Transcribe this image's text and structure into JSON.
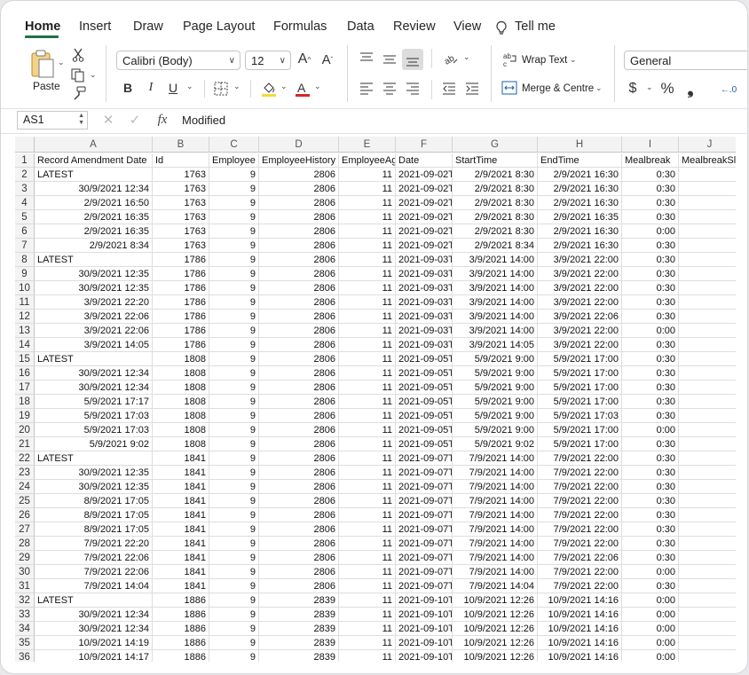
{
  "ribbon": {
    "tabs": [
      "Home",
      "Insert",
      "Draw",
      "Page Layout",
      "Formulas",
      "Data",
      "Review",
      "View",
      "Tell me"
    ],
    "active_tab": "Home",
    "paste_label": "Paste",
    "font_name": "Calibri (Body)",
    "font_size": "12",
    "wrap_text_label": "Wrap Text",
    "merge_label": "Merge & Centre",
    "number_format": "General",
    "accent_color": "#1e7145",
    "highlight_color": "#f4d83a",
    "font_color": "#d9262c"
  },
  "formula_bar": {
    "name_box": "AS1",
    "fx_label": "fx",
    "content": "Modified"
  },
  "sheet": {
    "columns": [
      "A",
      "B",
      "C",
      "D",
      "E",
      "F",
      "G",
      "H",
      "I",
      "J"
    ],
    "rows": [
      [
        "Record Amendment Date",
        "Id",
        "Employee",
        "EmployeeHistory",
        "EmployeeAg",
        "Date",
        "StartTime",
        "EndTime",
        "Mealbreak",
        "MealbreakSl"
      ],
      [
        "LATEST",
        "1763",
        "9",
        "2806",
        "11",
        "2021-09-02T",
        "2/9/2021 8:30",
        "2/9/2021 16:30",
        "0:30",
        ""
      ],
      [
        "30/9/2021 12:34",
        "1763",
        "9",
        "2806",
        "11",
        "2021-09-02T",
        "2/9/2021 8:30",
        "2/9/2021 16:30",
        "0:30",
        ""
      ],
      [
        "2/9/2021 16:50",
        "1763",
        "9",
        "2806",
        "11",
        "2021-09-02T",
        "2/9/2021 8:30",
        "2/9/2021 16:30",
        "0:30",
        ""
      ],
      [
        "2/9/2021 16:35",
        "1763",
        "9",
        "2806",
        "11",
        "2021-09-02T",
        "2/9/2021 8:30",
        "2/9/2021 16:35",
        "0:30",
        ""
      ],
      [
        "2/9/2021 16:35",
        "1763",
        "9",
        "2806",
        "11",
        "2021-09-02T",
        "2/9/2021 8:30",
        "2/9/2021 16:30",
        "0:00",
        ""
      ],
      [
        "2/9/2021 8:34",
        "1763",
        "9",
        "2806",
        "11",
        "2021-09-02T",
        "2/9/2021 8:34",
        "2/9/2021 16:30",
        "0:30",
        ""
      ],
      [
        "LATEST",
        "1786",
        "9",
        "2806",
        "11",
        "2021-09-03T",
        "3/9/2021 14:00",
        "3/9/2021 22:00",
        "0:30",
        ""
      ],
      [
        "30/9/2021 12:35",
        "1786",
        "9",
        "2806",
        "11",
        "2021-09-03T",
        "3/9/2021 14:00",
        "3/9/2021 22:00",
        "0:30",
        ""
      ],
      [
        "30/9/2021 12:35",
        "1786",
        "9",
        "2806",
        "11",
        "2021-09-03T",
        "3/9/2021 14:00",
        "3/9/2021 22:00",
        "0:30",
        ""
      ],
      [
        "3/9/2021 22:20",
        "1786",
        "9",
        "2806",
        "11",
        "2021-09-03T",
        "3/9/2021 14:00",
        "3/9/2021 22:00",
        "0:30",
        ""
      ],
      [
        "3/9/2021 22:06",
        "1786",
        "9",
        "2806",
        "11",
        "2021-09-03T",
        "3/9/2021 14:00",
        "3/9/2021 22:06",
        "0:30",
        ""
      ],
      [
        "3/9/2021 22:06",
        "1786",
        "9",
        "2806",
        "11",
        "2021-09-03T",
        "3/9/2021 14:00",
        "3/9/2021 22:00",
        "0:00",
        ""
      ],
      [
        "3/9/2021 14:05",
        "1786",
        "9",
        "2806",
        "11",
        "2021-09-03T",
        "3/9/2021 14:05",
        "3/9/2021 22:00",
        "0:30",
        ""
      ],
      [
        "LATEST",
        "1808",
        "9",
        "2806",
        "11",
        "2021-09-05T",
        "5/9/2021 9:00",
        "5/9/2021 17:00",
        "0:30",
        ""
      ],
      [
        "30/9/2021 12:34",
        "1808",
        "9",
        "2806",
        "11",
        "2021-09-05T",
        "5/9/2021 9:00",
        "5/9/2021 17:00",
        "0:30",
        ""
      ],
      [
        "30/9/2021 12:34",
        "1808",
        "9",
        "2806",
        "11",
        "2021-09-05T",
        "5/9/2021 9:00",
        "5/9/2021 17:00",
        "0:30",
        ""
      ],
      [
        "5/9/2021 17:17",
        "1808",
        "9",
        "2806",
        "11",
        "2021-09-05T",
        "5/9/2021 9:00",
        "5/9/2021 17:00",
        "0:30",
        ""
      ],
      [
        "5/9/2021 17:03",
        "1808",
        "9",
        "2806",
        "11",
        "2021-09-05T",
        "5/9/2021 9:00",
        "5/9/2021 17:03",
        "0:30",
        ""
      ],
      [
        "5/9/2021 17:03",
        "1808",
        "9",
        "2806",
        "11",
        "2021-09-05T",
        "5/9/2021 9:00",
        "5/9/2021 17:00",
        "0:00",
        ""
      ],
      [
        "5/9/2021 9:02",
        "1808",
        "9",
        "2806",
        "11",
        "2021-09-05T",
        "5/9/2021 9:02",
        "5/9/2021 17:00",
        "0:30",
        ""
      ],
      [
        "LATEST",
        "1841",
        "9",
        "2806",
        "11",
        "2021-09-07T",
        "7/9/2021 14:00",
        "7/9/2021 22:00",
        "0:30",
        ""
      ],
      [
        "30/9/2021 12:35",
        "1841",
        "9",
        "2806",
        "11",
        "2021-09-07T",
        "7/9/2021 14:00",
        "7/9/2021 22:00",
        "0:30",
        ""
      ],
      [
        "30/9/2021 12:35",
        "1841",
        "9",
        "2806",
        "11",
        "2021-09-07T",
        "7/9/2021 14:00",
        "7/9/2021 22:00",
        "0:30",
        ""
      ],
      [
        "8/9/2021 17:05",
        "1841",
        "9",
        "2806",
        "11",
        "2021-09-07T",
        "7/9/2021 14:00",
        "7/9/2021 22:00",
        "0:30",
        ""
      ],
      [
        "8/9/2021 17:05",
        "1841",
        "9",
        "2806",
        "11",
        "2021-09-07T",
        "7/9/2021 14:00",
        "7/9/2021 22:00",
        "0:30",
        ""
      ],
      [
        "8/9/2021 17:05",
        "1841",
        "9",
        "2806",
        "11",
        "2021-09-07T",
        "7/9/2021 14:00",
        "7/9/2021 22:00",
        "0:30",
        ""
      ],
      [
        "7/9/2021 22:20",
        "1841",
        "9",
        "2806",
        "11",
        "2021-09-07T",
        "7/9/2021 14:00",
        "7/9/2021 22:00",
        "0:30",
        ""
      ],
      [
        "7/9/2021 22:06",
        "1841",
        "9",
        "2806",
        "11",
        "2021-09-07T",
        "7/9/2021 14:00",
        "7/9/2021 22:06",
        "0:30",
        ""
      ],
      [
        "7/9/2021 22:06",
        "1841",
        "9",
        "2806",
        "11",
        "2021-09-07T",
        "7/9/2021 14:00",
        "7/9/2021 22:00",
        "0:00",
        ""
      ],
      [
        "7/9/2021 14:04",
        "1841",
        "9",
        "2806",
        "11",
        "2021-09-07T",
        "7/9/2021 14:04",
        "7/9/2021 22:00",
        "0:30",
        ""
      ],
      [
        "LATEST",
        "1886",
        "9",
        "2839",
        "11",
        "2021-09-10T",
        "10/9/2021 12:26",
        "10/9/2021 14:16",
        "0:00",
        ""
      ],
      [
        "30/9/2021 12:34",
        "1886",
        "9",
        "2839",
        "11",
        "2021-09-10T",
        "10/9/2021 12:26",
        "10/9/2021 14:16",
        "0:00",
        ""
      ],
      [
        "30/9/2021 12:34",
        "1886",
        "9",
        "2839",
        "11",
        "2021-09-10T",
        "10/9/2021 12:26",
        "10/9/2021 14:16",
        "0:00",
        ""
      ],
      [
        "10/9/2021 14:19",
        "1886",
        "9",
        "2839",
        "11",
        "2021-09-10T",
        "10/9/2021 12:26",
        "10/9/2021 14:16",
        "0:00",
        ""
      ],
      [
        "10/9/2021 14:17",
        "1886",
        "9",
        "2839",
        "11",
        "2021-09-10T",
        "10/9/2021 12:26",
        "10/9/2021 14:16",
        "0:00",
        ""
      ]
    ]
  }
}
